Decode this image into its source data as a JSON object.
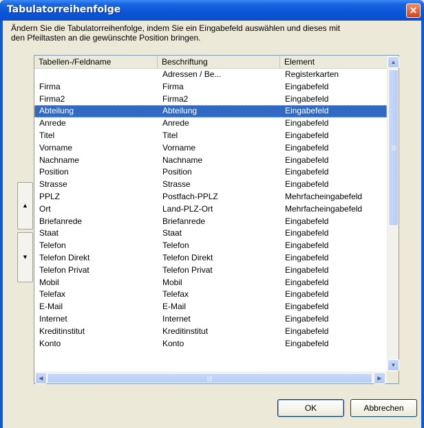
{
  "window": {
    "title": "Tabulatorreihenfolge",
    "close_label": "✕"
  },
  "description": {
    "line1": "Ändern Sie die Tabulatorreihenfolge, indem Sie ein Eingabefeld auswählen und dieses mit",
    "line2": "den Pfeiltasten an die gewünschte Position bringen."
  },
  "table": {
    "columns": [
      "Tabellen-/Feldname",
      "Beschriftung",
      "Element"
    ],
    "selected_index": 3,
    "rows": [
      [
        "",
        "Adressen / Be...",
        "Registerkarten"
      ],
      [
        "Firma",
        "Firma",
        "Eingabefeld"
      ],
      [
        "Firma2",
        "Firma2",
        "Eingabefeld"
      ],
      [
        "Abteilung",
        "Abteilung",
        "Eingabefeld"
      ],
      [
        "Anrede",
        "Anrede",
        "Eingabefeld"
      ],
      [
        "Titel",
        "Titel",
        "Eingabefeld"
      ],
      [
        "Vorname",
        "Vorname",
        "Eingabefeld"
      ],
      [
        "Nachname",
        "Nachname",
        "Eingabefeld"
      ],
      [
        "Position",
        "Position",
        "Eingabefeld"
      ],
      [
        "Strasse",
        "Strasse",
        "Eingabefeld"
      ],
      [
        "PPLZ",
        "Postfach-PPLZ",
        "Mehrfacheingabefeld"
      ],
      [
        "Ort",
        "Land-PLZ-Ort",
        "Mehrfacheingabefeld"
      ],
      [
        "Briefanrede",
        "Briefanrede",
        "Eingabefeld"
      ],
      [
        "Staat",
        "Staat",
        "Eingabefeld"
      ],
      [
        "Telefon",
        "Telefon",
        "Eingabefeld"
      ],
      [
        "Telefon Direkt",
        "Telefon Direkt",
        "Eingabefeld"
      ],
      [
        "Telefon Privat",
        "Telefon Privat",
        "Eingabefeld"
      ],
      [
        "Mobil",
        "Mobil",
        "Eingabefeld"
      ],
      [
        "Telefax",
        "Telefax",
        "Eingabefeld"
      ],
      [
        "E-Mail",
        "E-Mail",
        "Eingabefeld"
      ],
      [
        "Internet",
        "Internet",
        "Eingabefeld"
      ],
      [
        "Kreditinstitut",
        "Kreditinstitut",
        "Eingabefeld"
      ],
      [
        "Konto",
        "Konto",
        "Eingabefeld"
      ]
    ]
  },
  "move_buttons": {
    "up_icon": "▲",
    "down_icon": "▼"
  },
  "scroll_icons": {
    "up": "▲",
    "down": "▼",
    "left": "◀",
    "right": "▶"
  },
  "buttons": {
    "ok": "OK",
    "cancel": "Abbrechen"
  },
  "colors": {
    "selection": "#316ac5",
    "titlebar": "#0a55d8",
    "dialog_bg": "#ece9d8"
  }
}
